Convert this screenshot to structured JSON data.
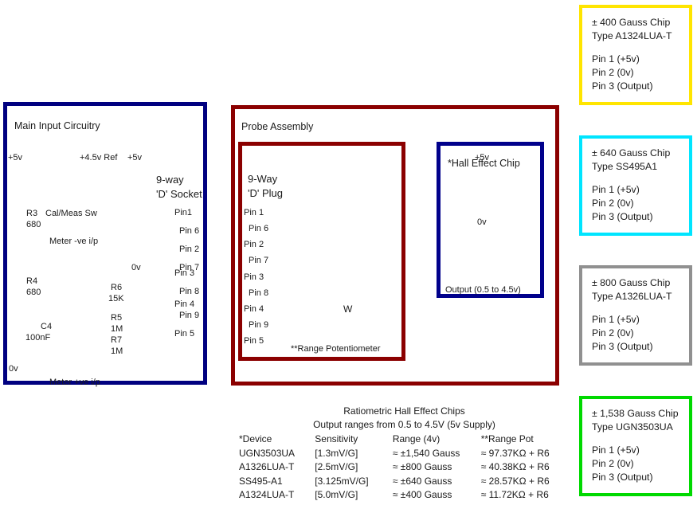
{
  "panels": {
    "main_input": {
      "title": "Main Input Circuitry"
    },
    "probe": {
      "title": "Probe Assembly"
    },
    "dplug": {
      "title_line1": "9-Way",
      "title_line2": "'D' Plug"
    },
    "dsocket": {
      "title_line1": "9-way",
      "title_line2": "'D' Socket"
    },
    "hall": {
      "title": "*Hall Effect Chip"
    }
  },
  "main_input": {
    "rail_5v_left": "+5v",
    "rail_45v_ref": "+4.5v Ref",
    "rail_5v_right": "+5v",
    "switch_label": "Cal/Meas Sw",
    "meter_neg": "Meter -ve i/p",
    "meter_pos": "Meter +ve i/p",
    "zero_v_left": "0v",
    "zero_v_mid": "0v",
    "resistors": [
      {
        "ref": "R3",
        "value": "680"
      },
      {
        "ref": "R4",
        "value": "680"
      },
      {
        "ref": "R6",
        "value": "15K"
      },
      {
        "ref": "R5",
        "value": "1M"
      },
      {
        "ref": "R7",
        "value": "1M"
      }
    ],
    "capacitor": {
      "ref": "C4",
      "value": "100nF"
    },
    "socket_pins": [
      "Pin1",
      "Pin 6",
      "Pin 2",
      "Pin 7",
      "Pin 3",
      "Pin 8",
      "Pin 4",
      "Pin 9",
      "Pin 5"
    ]
  },
  "probe": {
    "plug_pins": [
      "Pin 1",
      "Pin 6",
      "Pin 2",
      "Pin 7",
      "Pin 3",
      "Pin 8",
      "Pin 4",
      "Pin 9",
      "Pin 5"
    ],
    "pot_label": "**Range Potentiometer",
    "pot_wiper": "W"
  },
  "hall": {
    "supply": "+5v",
    "ground": "0v",
    "output": "Output (0.5 to 4.5v)"
  },
  "chips": [
    {
      "id": "chip-400",
      "border_color": "#ffe500",
      "line1": "± 400 Gauss Chip",
      "line2": "Type A1324LUA-T",
      "pin1": "Pin 1 (+5v)",
      "pin2": "Pin 2 (0v)",
      "pin3": "Pin 3 (Output)"
    },
    {
      "id": "chip-640",
      "border_color": "#00e5ff",
      "line1": "± 640 Gauss Chip",
      "line2": "Type SS495A1",
      "pin1": "Pin 1 (+5v)",
      "pin2": "Pin 2 (0v)",
      "pin3": "Pin 3 (Output)"
    },
    {
      "id": "chip-800",
      "border_color": "#909090",
      "line1": "± 800 Gauss Chip",
      "line2": "Type A1326LUA-T",
      "pin1": "Pin 1 (+5v)",
      "pin2": "Pin 2 (0v)",
      "pin3": "Pin 3 (Output)"
    },
    {
      "id": "chip-1538",
      "border_color": "#00d900",
      "line1": "± 1,538 Gauss Chip",
      "line2": "Type UGN3503UA",
      "pin1": "Pin 1 (+5v)",
      "pin2": "Pin 2 (0v)",
      "pin3": "Pin 3 (Output)"
    }
  ],
  "spec_table": {
    "title": "Ratiometric Hall Effect Chips",
    "subtitle": "Output ranges from 0.5 to 4.5V (5v Supply)",
    "headers": [
      "*Device",
      "Sensitivity",
      "Range (4v)",
      "**Range Pot"
    ],
    "rows": [
      [
        "UGN3503UA",
        "[1.3mV/G]",
        "≈ ±1,540 Gauss",
        "≈ 97.37KΩ + R6"
      ],
      [
        "A1326LUA-T",
        "[2.5mV/G]",
        "≈ ±800 Gauss",
        "≈ 40.38KΩ + R6"
      ],
      [
        "SS495-A1",
        "[3.125mV/G]",
        "≈ ±640 Gauss",
        "≈ 28.57KΩ + R6"
      ],
      [
        "A1324LUA-T",
        "[5.0mV/G]",
        "≈ ±400 Gauss",
        "≈ 11.72KΩ + R6"
      ]
    ]
  },
  "colors": {
    "wire": "#6a6ad8",
    "node": "#0000cc",
    "main_border": "#000080",
    "probe_border": "#8b0000",
    "hall_border": "#00008b",
    "component_fill": "#ccccee",
    "component_stroke": "#000080"
  }
}
